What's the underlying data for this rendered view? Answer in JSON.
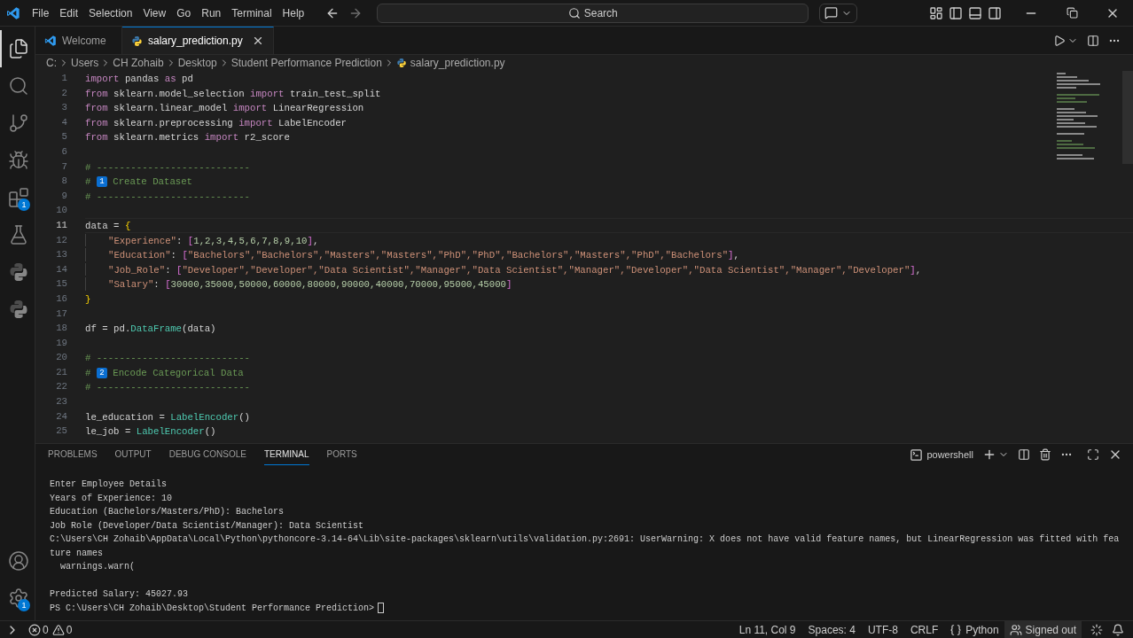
{
  "menu": [
    "File",
    "Edit",
    "Selection",
    "View",
    "Go",
    "Run",
    "Terminal",
    "Help"
  ],
  "search": {
    "placeholder": "Search"
  },
  "activity_bar": [
    {
      "kind": "files",
      "selected": true
    },
    {
      "kind": "search",
      "selected": false
    },
    {
      "kind": "source-control",
      "selected": false
    },
    {
      "kind": "run-debug",
      "selected": false
    },
    {
      "kind": "extensions",
      "selected": false,
      "badge": "1"
    },
    {
      "kind": "testing",
      "selected": false
    },
    {
      "kind": "python",
      "selected": false
    },
    {
      "kind": "python",
      "selected": false
    }
  ],
  "activity_bottom": [
    {
      "kind": "account"
    },
    {
      "kind": "settings",
      "badge": "1"
    }
  ],
  "tabs": [
    {
      "label": "Welcome",
      "kind": "vscode",
      "selected": false
    },
    {
      "label": "salary_prediction.py",
      "kind": "python",
      "selected": true
    }
  ],
  "breadcrumb": [
    {
      "label": "C:",
      "kind": "folder"
    },
    {
      "label": "Users",
      "kind": "folder"
    },
    {
      "label": "CH Zohaib",
      "kind": "folder"
    },
    {
      "label": "Desktop",
      "kind": "folder"
    },
    {
      "label": "Student Performance Prediction",
      "kind": "folder"
    },
    {
      "label": "salary_prediction.py",
      "kind": "python"
    }
  ],
  "editor": {
    "lines": [
      {
        "n": "1",
        "current": false,
        "tokens": [
          {
            "kind": "kw",
            "text": "import"
          },
          {
            "kind": "p",
            "text": " pandas "
          },
          {
            "kind": "kw",
            "text": "as"
          },
          {
            "kind": "p",
            "text": " pd"
          }
        ]
      },
      {
        "n": "2",
        "current": false,
        "tokens": [
          {
            "kind": "kw",
            "text": "from"
          },
          {
            "kind": "p",
            "text": " sklearn.model_selection "
          },
          {
            "kind": "kw",
            "text": "import"
          },
          {
            "kind": "p",
            "text": " train_test_split"
          }
        ]
      },
      {
        "n": "3",
        "current": false,
        "tokens": [
          {
            "kind": "kw",
            "text": "from"
          },
          {
            "kind": "p",
            "text": " sklearn.linear_model "
          },
          {
            "kind": "kw",
            "text": "import"
          },
          {
            "kind": "p",
            "text": " LinearRegression"
          }
        ]
      },
      {
        "n": "4",
        "current": false,
        "tokens": [
          {
            "kind": "kw",
            "text": "from"
          },
          {
            "kind": "p",
            "text": " sklearn.preprocessing "
          },
          {
            "kind": "kw",
            "text": "import"
          },
          {
            "kind": "p",
            "text": " LabelEncoder"
          }
        ]
      },
      {
        "n": "5",
        "current": false,
        "tokens": [
          {
            "kind": "kw",
            "text": "from"
          },
          {
            "kind": "p",
            "text": " sklearn.metrics "
          },
          {
            "kind": "kw",
            "text": "import"
          },
          {
            "kind": "p",
            "text": " r2_score"
          }
        ]
      },
      {
        "n": "6",
        "current": false
      },
      {
        "n": "7",
        "current": false,
        "tokens": [
          {
            "kind": "cm",
            "text": "# ---------------------------"
          }
        ]
      },
      {
        "n": "8",
        "current": false,
        "tokens": [
          {
            "kind": "cm",
            "text": "# "
          },
          {
            "kind": "badge",
            "text": "1"
          },
          {
            "kind": "cm",
            "text": " Create Dataset"
          }
        ]
      },
      {
        "n": "9",
        "current": false,
        "tokens": [
          {
            "kind": "cm",
            "text": "# ---------------------------"
          }
        ]
      },
      {
        "n": "10",
        "current": false
      },
      {
        "n": "11",
        "current": true,
        "tokens": [
          {
            "kind": "p",
            "text": "data = "
          },
          {
            "kind": "b1",
            "text": "{"
          }
        ],
        "children": [
          {
            "n": "12",
            "current": false,
            "tokens": [
              {
                "kind": "str",
                "text": "\"Experience\""
              },
              {
                "kind": "p",
                "text": ": "
              },
              {
                "kind": "b2",
                "text": "["
              },
              {
                "kind": "num",
                "text": "1,2,3,4,5,6,7,8,9,10"
              },
              {
                "kind": "b2",
                "text": "]"
              },
              {
                "kind": "p",
                "text": ","
              }
            ]
          },
          {
            "n": "13",
            "current": false,
            "tokens": [
              {
                "kind": "str",
                "text": "\"Education\""
              },
              {
                "kind": "p",
                "text": ": "
              },
              {
                "kind": "b2",
                "text": "["
              },
              {
                "kind": "str",
                "text": "\"Bachelors\",\"Bachelors\",\"Masters\",\"Masters\",\"PhD\",\"PhD\",\"Bachelors\",\"Masters\",\"PhD\",\"Bachelors\""
              },
              {
                "kind": "b2",
                "text": "]"
              },
              {
                "kind": "p",
                "text": ","
              }
            ]
          },
          {
            "n": "14",
            "current": false,
            "tokens": [
              {
                "kind": "str",
                "text": "\"Job_Role\""
              },
              {
                "kind": "p",
                "text": ": "
              },
              {
                "kind": "b2",
                "text": "["
              },
              {
                "kind": "str",
                "text": "\"Developer\",\"Developer\",\"Data Scientist\",\"Manager\",\"Data Scientist\",\"Manager\",\"Developer\",\"Data Scientist\",\"Manager\",\"Developer\""
              },
              {
                "kind": "b2",
                "text": "]"
              },
              {
                "kind": "p",
                "text": ","
              }
            ]
          },
          {
            "n": "15",
            "current": false,
            "tokens": [
              {
                "kind": "str",
                "text": "\"Salary\""
              },
              {
                "kind": "p",
                "text": ": "
              },
              {
                "kind": "b2",
                "text": "["
              },
              {
                "kind": "num",
                "text": "30000,35000,50000,60000,80000,90000,40000,70000,95000,45000"
              },
              {
                "kind": "b2",
                "text": "]"
              }
            ]
          }
        ]
      },
      {
        "n": "16",
        "current": false,
        "tokens": [
          {
            "kind": "b1",
            "text": "}"
          }
        ]
      },
      {
        "n": "17",
        "current": false
      },
      {
        "n": "18",
        "current": false,
        "tokens": [
          {
            "kind": "p",
            "text": "df = pd."
          },
          {
            "kind": "fn",
            "text": "DataFrame"
          },
          {
            "kind": "p",
            "text": "(data)"
          }
        ]
      },
      {
        "n": "19",
        "current": false
      },
      {
        "n": "20",
        "current": false,
        "tokens": [
          {
            "kind": "cm",
            "text": "# ---------------------------"
          }
        ]
      },
      {
        "n": "21",
        "current": false,
        "tokens": [
          {
            "kind": "cm",
            "text": "# "
          },
          {
            "kind": "badge",
            "text": "2"
          },
          {
            "kind": "cm",
            "text": " Encode Categorical Data"
          }
        ]
      },
      {
        "n": "22",
        "current": false,
        "tokens": [
          {
            "kind": "cm",
            "text": "# ---------------------------"
          }
        ]
      },
      {
        "n": "23",
        "current": false
      },
      {
        "n": "24",
        "current": false,
        "tokens": [
          {
            "kind": "p",
            "text": "le_education = "
          },
          {
            "kind": "fn",
            "text": "LabelEncoder"
          },
          {
            "kind": "p",
            "text": "()"
          }
        ]
      },
      {
        "n": "25",
        "current": false,
        "tokens": [
          {
            "kind": "p",
            "text": "le_job = "
          },
          {
            "kind": "fn",
            "text": "LabelEncoder"
          },
          {
            "kind": "p",
            "text": "()"
          }
        ]
      }
    ]
  },
  "panel": {
    "tabs": [
      {
        "label": "PROBLEMS",
        "selected": false
      },
      {
        "label": "OUTPUT",
        "selected": false
      },
      {
        "label": "DEBUG CONSOLE",
        "selected": false
      },
      {
        "label": "TERMINAL",
        "selected": true
      },
      {
        "label": "PORTS",
        "selected": false
      }
    ],
    "terminal_name": "powershell",
    "blocks": [
      [
        "Enter Employee Details",
        "Years of Experience: 10",
        "Education (Bachelors/Masters/PhD): Bachelors",
        "Job Role (Developer/Data Scientist/Manager): Data Scientist",
        "C:\\Users\\CH Zohaib\\AppData\\Local\\Python\\pythoncore-3.14-64\\Lib\\site-packages\\sklearn\\utils\\validation.py:2691: UserWarning: X does not have valid feature names, but LinearRegression was fitted with fea",
        "ture names",
        "  warnings.warn("
      ],
      [
        "Predicted Salary: 45027.93",
        "PS C:\\Users\\CH Zohaib\\Desktop\\Student Performance Prediction>"
      ]
    ]
  },
  "status_bar": {
    "errors": "0",
    "warnings": "0",
    "right": [
      {
        "text": "Ln 11, Col 9",
        "kind": "plain"
      },
      {
        "text": "Spaces: 4",
        "kind": "plain"
      },
      {
        "text": "UTF-8",
        "kind": "plain"
      },
      {
        "text": "CRLF",
        "kind": "plain"
      },
      {
        "text": "Python",
        "kind": "language"
      },
      {
        "text": "Signed out",
        "kind": "account"
      }
    ]
  }
}
